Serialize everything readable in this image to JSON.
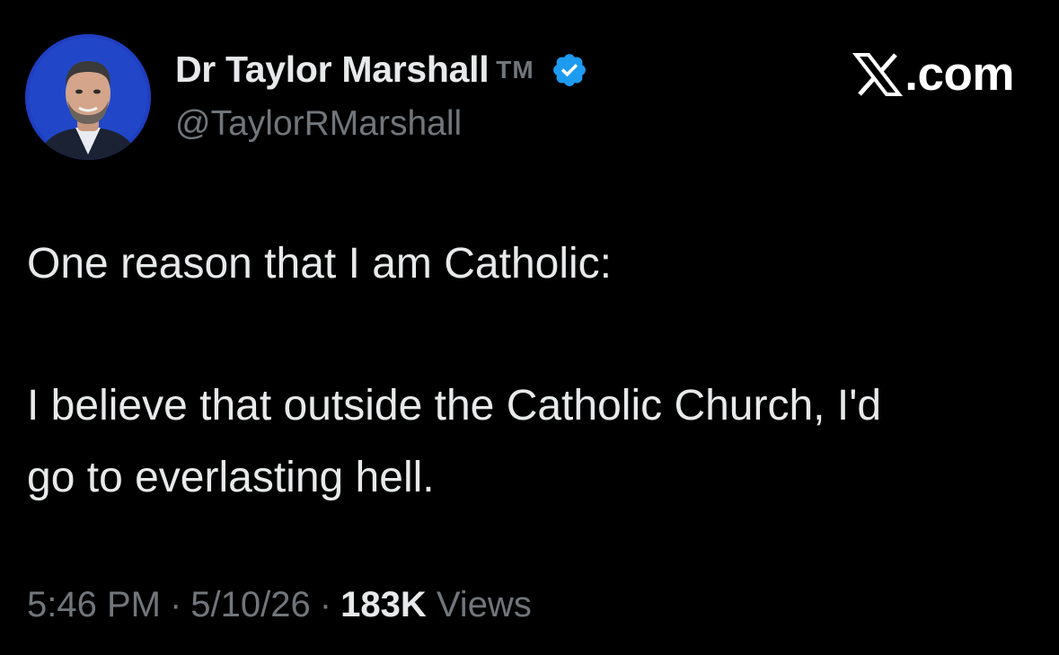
{
  "author": {
    "display_name": "Dr Taylor Marshall",
    "trademark": "TM",
    "handle": "@TaylorRMarshall",
    "verified": true,
    "avatar_icon": "profile-photo"
  },
  "brand": {
    "label": ".com",
    "icon": "x-logo-icon"
  },
  "tweet": {
    "lines": [
      "One reason that I am Catholic:",
      "I believe that outside the Catholic Church, I'd",
      "go to everlasting hell."
    ]
  },
  "meta": {
    "time": "5:46 PM",
    "date": "5/10/26",
    "separator": "·",
    "views_count": "183K",
    "views_label": "Views"
  },
  "colors": {
    "background": "#000000",
    "primary_text": "#e7e9ea",
    "secondary_text": "#71767b",
    "verified_badge": "#1d9bf0"
  }
}
